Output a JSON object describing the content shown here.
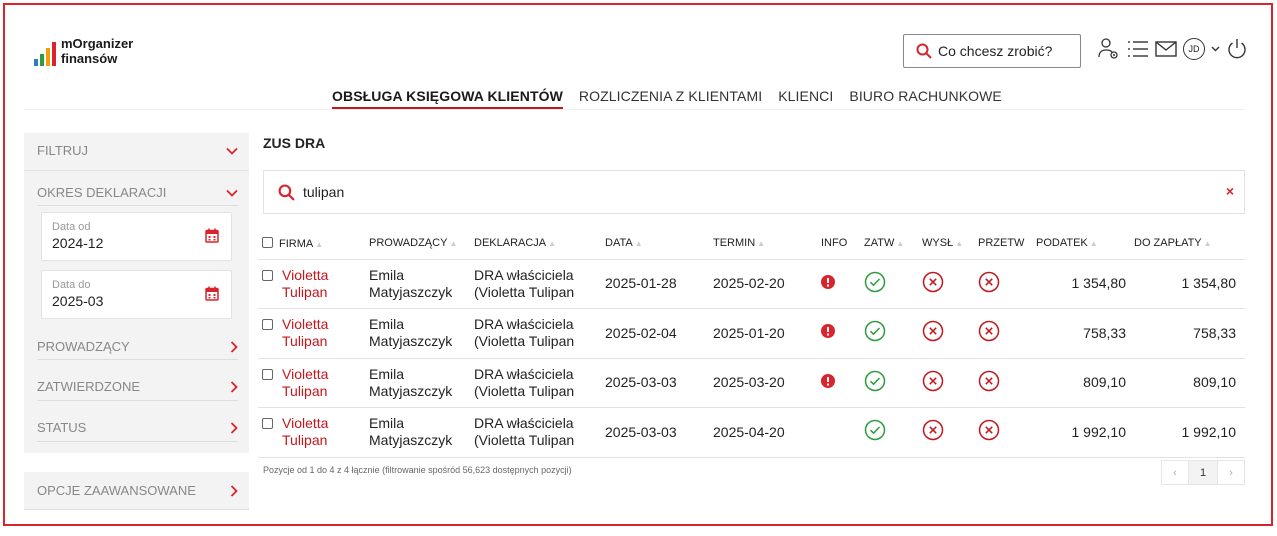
{
  "brand": {
    "name_line1": "mOrganizer",
    "name_line2": "finansów",
    "bar_colors": [
      "#2a7fc1",
      "#2f9b3f",
      "#f2a007",
      "#d9232d"
    ]
  },
  "header": {
    "search_placeholder": "Co chcesz zrobić?",
    "user_initials": "JD"
  },
  "nav": {
    "items": [
      "OBSŁUGA KSIĘGOWA KLIENTÓW",
      "ROZLICZENIA Z KLIENTAMI",
      "KLIENCI",
      "BIURO RACHUNKOWE"
    ],
    "active": 0
  },
  "sidebar": {
    "filter": "FILTRUJ",
    "period": "OKRES DEKLARACJI",
    "date_from_label": "Data od",
    "date_from": "2024-12",
    "date_to_label": "Data do",
    "date_to": "2025-03",
    "prowadzacy": "PROWADZĄCY",
    "zatwierdzone": "ZATWIERDZONE",
    "status": "STATUS",
    "advanced": "OPCJE ZAAWANSOWANE"
  },
  "main": {
    "title": "ZUS DRA",
    "search_value": "tulipan",
    "clear_icon": "×",
    "columns": [
      "FIRMA",
      "PROWADZĄCY",
      "DEKLARACJA",
      "DATA",
      "TERMIN",
      "INFO",
      "ZATW",
      "WYSŁ",
      "PRZETW",
      "PODATEK",
      "DO ZAPŁATY"
    ],
    "rows": [
      {
        "firma_1": "Violetta",
        "firma_2": "Tulipan",
        "prow_1": "Emila",
        "prow_2": "Matyjaszczyk",
        "dekl_1": "DRA właściciela",
        "dekl_2": "(Violetta Tulipan",
        "data": "2025-01-28",
        "termin": "2025-02-20",
        "info": true,
        "podatek": "1 354,80",
        "doZaplaty": "1 354,80"
      },
      {
        "firma_1": "Violetta",
        "firma_2": "Tulipan",
        "prow_1": "Emila",
        "prow_2": "Matyjaszczyk",
        "dekl_1": "DRA właściciela",
        "dekl_2": "(Violetta Tulipan",
        "data": "2025-02-04",
        "termin": "2025-01-20",
        "info": true,
        "podatek": "758,33",
        "doZaplaty": "758,33"
      },
      {
        "firma_1": "Violetta",
        "firma_2": "Tulipan",
        "prow_1": "Emila",
        "prow_2": "Matyjaszczyk",
        "dekl_1": "DRA właściciela",
        "dekl_2": "(Violetta Tulipan",
        "data": "2025-03-03",
        "termin": "2025-03-20",
        "info": true,
        "podatek": "809,10",
        "doZaplaty": "809,10"
      },
      {
        "firma_1": "Violetta",
        "firma_2": "Tulipan",
        "prow_1": "Emila",
        "prow_2": "Matyjaszczyk",
        "dekl_1": "DRA właściciela",
        "dekl_2": "(Violetta Tulipan",
        "data": "2025-03-03",
        "termin": "2025-04-20",
        "info": false,
        "podatek": "1 992,10",
        "doZaplaty": "1 992,10"
      }
    ],
    "footer": "Pozycje od 1 do 4 z 4 łącznie (filtrowanie spośród 56,623 dostępnych pozycji)",
    "page": "1",
    "prev_icon": "‹",
    "next_icon": "›"
  },
  "colors": {
    "accent": "#d9232d",
    "ok": "#2f9b3f"
  }
}
